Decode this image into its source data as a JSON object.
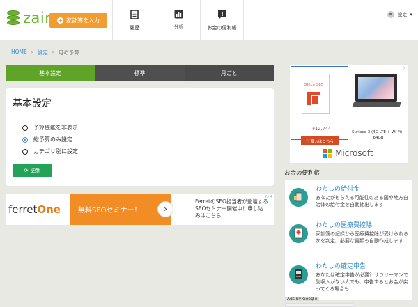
{
  "header": {
    "logo_text": "zaim",
    "input_button": "家計簿を入力",
    "nav": [
      {
        "label": "履歴",
        "icon": "history-book-icon"
      },
      {
        "label": "分析",
        "icon": "bar-chart-icon"
      },
      {
        "label": "お金の便利帳",
        "icon": "notebook-alert-icon"
      }
    ],
    "settings_label": "設定"
  },
  "breadcrumb": {
    "home": "HOME",
    "settings": "設定",
    "current": "月の予算"
  },
  "tabs": [
    {
      "label": "基本設定",
      "active": true
    },
    {
      "label": "標準",
      "active": false
    },
    {
      "label": "月ごと",
      "active": false
    }
  ],
  "card": {
    "title": "基本設定",
    "options": [
      {
        "label": "予算機能を非表示",
        "selected": false
      },
      {
        "label": "総予算のみ設定",
        "selected": true
      },
      {
        "label": "カテゴリ別に設定",
        "selected": false
      }
    ],
    "update_button": "更新"
  },
  "ad_ferret": {
    "logo_a": "ferret",
    "logo_b": "One",
    "banner": "無料SEOセミナー！",
    "text": "FerretのSEO担当者が登壇する SEOセミナー開催中！申し込みはこちら"
  },
  "ad_microsoft": {
    "product1_title": "Office 365",
    "price": "¥12,744",
    "buy_button": "購入はこちら",
    "product2_caption": "Surface 3 (4G LTE + Wi-Fi) - 64GB",
    "brand": "Microsoft"
  },
  "sidebar": {
    "title": "お金の便利帳",
    "features": [
      {
        "title": "わたしの給付金",
        "desc": "あなたがもらえる可能性のある国や地方自治体の給付金を自動抽出します"
      },
      {
        "title": "わたしの医療費控除",
        "desc": "家計簿の記録から医療費控除が受けられるかを判定。必要な書類も自動作成します"
      },
      {
        "title": "わたしの確定申告",
        "desc": "あなたは確定申告が必要？サラリーマンで副収入がない人でも、申告するとお金が戻ってくる場合も"
      }
    ],
    "ads_by": "Ads by Google"
  },
  "colors": {
    "brand_green": "#6ab42e",
    "orange": "#f39c2f",
    "active_tab": "#5fa328",
    "update_green": "#23a358",
    "teal_icon": "#2a9d94",
    "link_blue": "#2b87c8"
  }
}
